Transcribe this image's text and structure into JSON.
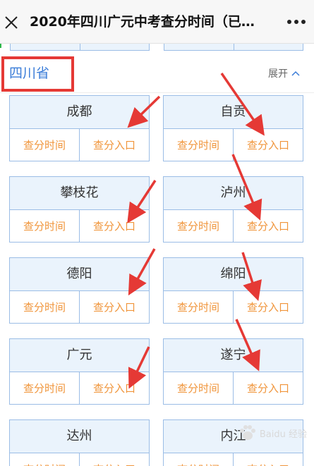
{
  "header": {
    "title": "2020年四川广元中考查分时间（已…",
    "close_icon": "close-icon",
    "more_icon": "more-icon"
  },
  "section": {
    "province": "四川省",
    "expand_label": "展开"
  },
  "buttons": {
    "time": "查分时间",
    "entry": "查分入口"
  },
  "cities": [
    {
      "name": "成都"
    },
    {
      "name": "自贡"
    },
    {
      "name": "攀枝花"
    },
    {
      "name": "泸州"
    },
    {
      "name": "德阳"
    },
    {
      "name": "绵阳"
    },
    {
      "name": "广元"
    },
    {
      "name": "遂宁"
    },
    {
      "name": "达州"
    },
    {
      "name": "内江"
    }
  ],
  "watermark": {
    "text": "Baidu 经验"
  },
  "colors": {
    "title_blue": "#3a7cd8",
    "card_border": "#9bbde6",
    "card_header_bg": "#eaf3fc",
    "button_orange": "#f0953b",
    "annotation_red": "#e53935"
  }
}
